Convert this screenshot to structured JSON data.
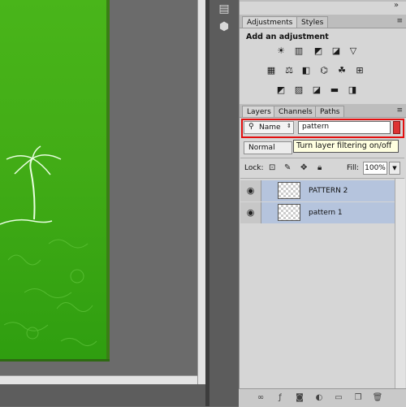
{
  "adjustments_panel": {
    "tabs": [
      {
        "label": "Adjustments"
      },
      {
        "label": "Styles"
      }
    ],
    "heading": "Add an adjustment",
    "icons": [
      [
        "brightness-contrast-icon",
        "levels-icon",
        "curves-icon",
        "exposure-icon"
      ],
      [
        "vibrance-icon",
        "hue-saturation-icon",
        "color-balance-icon",
        "black-white-icon",
        "photo-filter-icon",
        "channel-mixer-icon",
        "color-lookup-icon"
      ],
      [
        "invert-icon",
        "posterize-icon",
        "threshold-icon",
        "gradient-map-icon",
        "selective-color-icon"
      ]
    ]
  },
  "layers_panel": {
    "tabs": [
      {
        "label": "Layers"
      },
      {
        "label": "Channels"
      },
      {
        "label": "Paths"
      }
    ],
    "filter": {
      "kind": "Name",
      "value": "pattern"
    },
    "tooltip": "Turn layer filtering on/off",
    "blend_mode": "Normal",
    "lock_label": "Lock:",
    "fill_label": "Fill:",
    "fill_value": "100%",
    "layers": [
      {
        "name": "PATTERN 2"
      },
      {
        "name": "pattern 1"
      }
    ]
  },
  "colors": {
    "filter_highlight": "#e31010",
    "layer_selected": "#b5c4dd",
    "document_green": "#42ac16"
  }
}
